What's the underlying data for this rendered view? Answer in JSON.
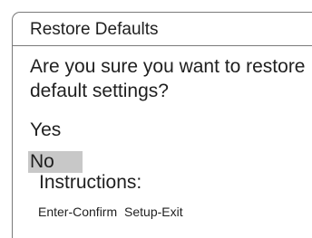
{
  "dialog": {
    "title": "Restore Defaults",
    "prompt": "Are you sure you want to restore default settings?",
    "options": {
      "yes": "Yes",
      "no": "No",
      "selected": "No"
    },
    "instructions": {
      "heading": "Instructions:",
      "confirm": "Enter-Confirm",
      "exit": "Setup-Exit"
    }
  }
}
